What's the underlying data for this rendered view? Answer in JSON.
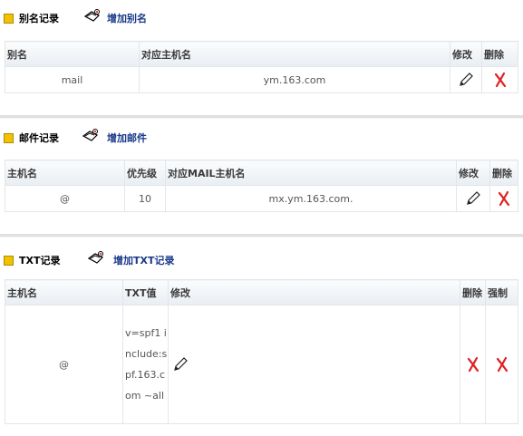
{
  "alias": {
    "title": "别名记录",
    "add_label": "增加别名",
    "headers": [
      "别名",
      "对应主机名",
      "修改",
      "删除"
    ],
    "rows": [
      {
        "alias": "mail",
        "target": "ym.163.com"
      }
    ],
    "icons": {
      "add": "add-record-icon",
      "edit": "pencil-icon",
      "delete": "red-x-icon"
    }
  },
  "mail": {
    "title": "邮件记录",
    "add_label": "增加邮件",
    "headers": [
      "主机名",
      "优先级",
      "对应MAIL主机名",
      "修改",
      "删除"
    ],
    "rows": [
      {
        "host": "@",
        "priority": "10",
        "target": "mx.ym.163.com."
      }
    ]
  },
  "txt": {
    "title": "TXT记录",
    "add_label": "增加TXT记录",
    "headers": [
      "主机名",
      "TXT值",
      "修改",
      "删除",
      "强制"
    ],
    "rows": [
      {
        "host": "@",
        "value": "v=spf1 include:spf.163.com ~all"
      }
    ]
  },
  "colors": {
    "bullet": "#f2c200",
    "link": "#1a3a8a",
    "delete": "#e02020",
    "header_bg": "#e9eef3"
  }
}
